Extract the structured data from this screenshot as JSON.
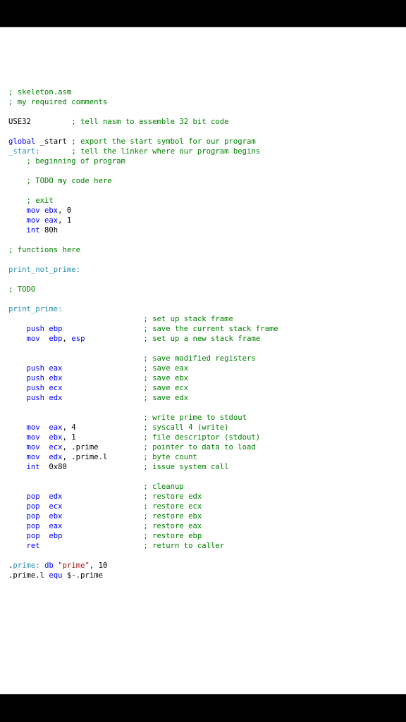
{
  "file": {
    "name": "skeleton.asm"
  },
  "colors": {
    "comment": "#008000",
    "keyword": "#0000ff",
    "label": "#2b91af",
    "string": "#a31515",
    "text": "#000000"
  },
  "lines": [
    [
      {
        "t": "; skeleton.asm",
        "c": "cm"
      }
    ],
    [
      {
        "t": "; my required comments",
        "c": "cm"
      }
    ],
    [],
    [
      {
        "t": "USE32         ",
        "c": "tx"
      },
      {
        "t": "; tell nasm to assemble 32 bit code",
        "c": "cm"
      }
    ],
    [],
    [
      {
        "t": "global",
        "c": "kw"
      },
      {
        "t": " _start ",
        "c": "tx"
      },
      {
        "t": "; export the start symbol for our program",
        "c": "cm"
      }
    ],
    [
      {
        "t": "_start:",
        "c": "lb"
      },
      {
        "t": "       ",
        "c": "tx"
      },
      {
        "t": "; tell the linker where our program begins",
        "c": "cm"
      }
    ],
    [
      {
        "t": "    ",
        "c": "tx"
      },
      {
        "t": "; beginning of program",
        "c": "cm"
      }
    ],
    [],
    [
      {
        "t": "    ",
        "c": "tx"
      },
      {
        "t": "; TODO my code here",
        "c": "cm"
      }
    ],
    [],
    [
      {
        "t": "    ",
        "c": "tx"
      },
      {
        "t": "; exit",
        "c": "cm"
      }
    ],
    [
      {
        "t": "    ",
        "c": "tx"
      },
      {
        "t": "mov ebx",
        "c": "kw"
      },
      {
        "t": ", 0",
        "c": "tx"
      }
    ],
    [
      {
        "t": "    ",
        "c": "tx"
      },
      {
        "t": "mov eax",
        "c": "kw"
      },
      {
        "t": ", 1",
        "c": "tx"
      }
    ],
    [
      {
        "t": "    ",
        "c": "tx"
      },
      {
        "t": "int",
        "c": "kw"
      },
      {
        "t": " 80h",
        "c": "tx"
      }
    ],
    [],
    [
      {
        "t": "; functions here",
        "c": "cm"
      }
    ],
    [],
    [
      {
        "t": "print_not_prime:",
        "c": "lb"
      }
    ],
    [],
    [
      {
        "t": "; TODO",
        "c": "cm"
      }
    ],
    [],
    [
      {
        "t": "print_prime:",
        "c": "lb"
      }
    ],
    [
      {
        "t": "                              ",
        "c": "tx"
      },
      {
        "t": "; set up stack frame",
        "c": "cm"
      }
    ],
    [
      {
        "t": "    ",
        "c": "tx"
      },
      {
        "t": "push ebp",
        "c": "kw"
      },
      {
        "t": "                  ",
        "c": "tx"
      },
      {
        "t": "; save the current stack frame",
        "c": "cm"
      }
    ],
    [
      {
        "t": "    ",
        "c": "tx"
      },
      {
        "t": "mov  ebp",
        "c": "kw"
      },
      {
        "t": ", ",
        "c": "tx"
      },
      {
        "t": "esp",
        "c": "kw"
      },
      {
        "t": "             ",
        "c": "tx"
      },
      {
        "t": "; set up a new stack frame",
        "c": "cm"
      }
    ],
    [],
    [
      {
        "t": "                              ",
        "c": "tx"
      },
      {
        "t": "; save modified registers",
        "c": "cm"
      }
    ],
    [
      {
        "t": "    ",
        "c": "tx"
      },
      {
        "t": "push eax",
        "c": "kw"
      },
      {
        "t": "                  ",
        "c": "tx"
      },
      {
        "t": "; save eax",
        "c": "cm"
      }
    ],
    [
      {
        "t": "    ",
        "c": "tx"
      },
      {
        "t": "push ebx",
        "c": "kw"
      },
      {
        "t": "                  ",
        "c": "tx"
      },
      {
        "t": "; save ebx",
        "c": "cm"
      }
    ],
    [
      {
        "t": "    ",
        "c": "tx"
      },
      {
        "t": "push ecx",
        "c": "kw"
      },
      {
        "t": "                  ",
        "c": "tx"
      },
      {
        "t": "; save ecx",
        "c": "cm"
      }
    ],
    [
      {
        "t": "    ",
        "c": "tx"
      },
      {
        "t": "push edx",
        "c": "kw"
      },
      {
        "t": "                  ",
        "c": "tx"
      },
      {
        "t": "; save edx",
        "c": "cm"
      }
    ],
    [],
    [
      {
        "t": "                              ",
        "c": "tx"
      },
      {
        "t": "; write prime to stdout",
        "c": "cm"
      }
    ],
    [
      {
        "t": "    ",
        "c": "tx"
      },
      {
        "t": "mov  eax",
        "c": "kw"
      },
      {
        "t": ", 4               ",
        "c": "tx"
      },
      {
        "t": "; syscall 4 (write)",
        "c": "cm"
      }
    ],
    [
      {
        "t": "    ",
        "c": "tx"
      },
      {
        "t": "mov  ebx",
        "c": "kw"
      },
      {
        "t": ", 1               ",
        "c": "tx"
      },
      {
        "t": "; file descriptor (stdout)",
        "c": "cm"
      }
    ],
    [
      {
        "t": "    ",
        "c": "tx"
      },
      {
        "t": "mov  ecx",
        "c": "kw"
      },
      {
        "t": ", .prime          ",
        "c": "tx"
      },
      {
        "t": "; pointer to data to load",
        "c": "cm"
      }
    ],
    [
      {
        "t": "    ",
        "c": "tx"
      },
      {
        "t": "mov  edx",
        "c": "kw"
      },
      {
        "t": ", .prime.l        ",
        "c": "tx"
      },
      {
        "t": "; byte count",
        "c": "cm"
      }
    ],
    [
      {
        "t": "    ",
        "c": "tx"
      },
      {
        "t": "int",
        "c": "kw"
      },
      {
        "t": "  0x80                 ",
        "c": "tx"
      },
      {
        "t": "; issue system call",
        "c": "cm"
      }
    ],
    [],
    [
      {
        "t": "                              ",
        "c": "tx"
      },
      {
        "t": "; cleanup",
        "c": "cm"
      }
    ],
    [
      {
        "t": "    ",
        "c": "tx"
      },
      {
        "t": "pop  edx",
        "c": "kw"
      },
      {
        "t": "                  ",
        "c": "tx"
      },
      {
        "t": "; restore edx",
        "c": "cm"
      }
    ],
    [
      {
        "t": "    ",
        "c": "tx"
      },
      {
        "t": "pop  ecx",
        "c": "kw"
      },
      {
        "t": "                  ",
        "c": "tx"
      },
      {
        "t": "; restore ecx",
        "c": "cm"
      }
    ],
    [
      {
        "t": "    ",
        "c": "tx"
      },
      {
        "t": "pop  ebx",
        "c": "kw"
      },
      {
        "t": "                  ",
        "c": "tx"
      },
      {
        "t": "; restore ebx",
        "c": "cm"
      }
    ],
    [
      {
        "t": "    ",
        "c": "tx"
      },
      {
        "t": "pop  eax",
        "c": "kw"
      },
      {
        "t": "                  ",
        "c": "tx"
      },
      {
        "t": "; restore eax",
        "c": "cm"
      }
    ],
    [
      {
        "t": "    ",
        "c": "tx"
      },
      {
        "t": "pop  ebp",
        "c": "kw"
      },
      {
        "t": "                  ",
        "c": "tx"
      },
      {
        "t": "; restore ebp",
        "c": "cm"
      }
    ],
    [
      {
        "t": "    ",
        "c": "tx"
      },
      {
        "t": "ret",
        "c": "kw"
      },
      {
        "t": "                       ",
        "c": "tx"
      },
      {
        "t": "; return to caller",
        "c": "cm"
      }
    ],
    [],
    [
      {
        "t": ".",
        "c": "tx"
      },
      {
        "t": "prime:",
        "c": "lb"
      },
      {
        "t": " ",
        "c": "tx"
      },
      {
        "t": "db",
        "c": "kw"
      },
      {
        "t": " ",
        "c": "tx"
      },
      {
        "t": "\"prime\"",
        "c": "st"
      },
      {
        "t": ", 10",
        "c": "tx"
      }
    ],
    [
      {
        "t": ".prime.l ",
        "c": "tx"
      },
      {
        "t": "equ",
        "c": "kw"
      },
      {
        "t": " $-.prime",
        "c": "tx"
      }
    ]
  ]
}
